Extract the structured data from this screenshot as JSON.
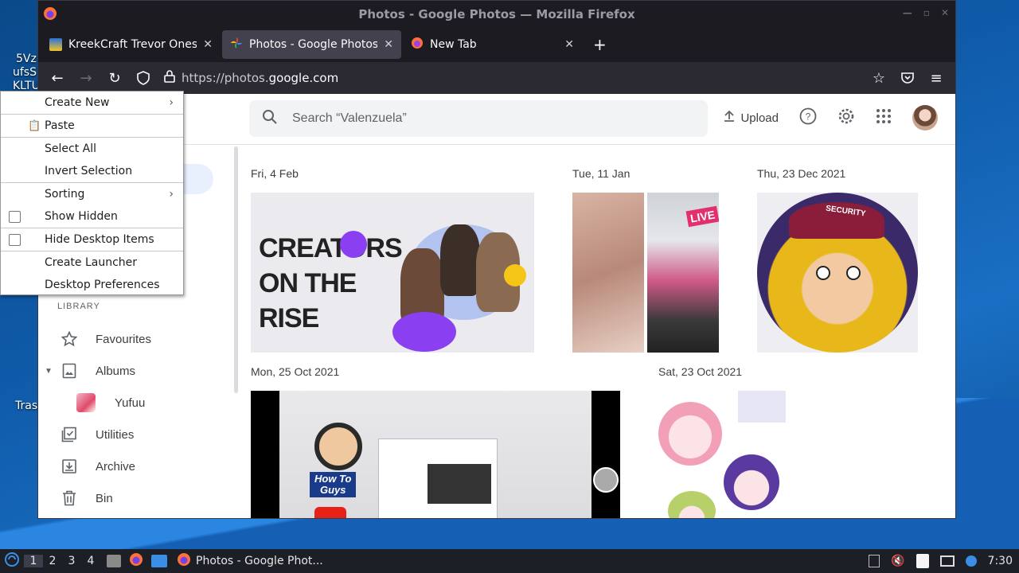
{
  "desktop": {
    "icon_text_1": "5Vz",
    "icon_text_2": "ufsS",
    "icon_text_3": "KLTU",
    "trash_text": "Tras"
  },
  "window": {
    "title": "Photos - Google Photos — Mozilla Firefox"
  },
  "tabs": [
    {
      "label": "KreekCraft Trevor Onesie"
    },
    {
      "label": "Photos - Google Photos"
    },
    {
      "label": "New Tab"
    }
  ],
  "navbar": {
    "url_prefix": "https://photos.",
    "url_host": "google.com"
  },
  "photos_page": {
    "search_placeholder": "Search “Valenzuela”",
    "upload_label": "Upload",
    "library_label": "LIBRARY",
    "sidebar": [
      {
        "label": "Favourites",
        "icon": "star-icon"
      },
      {
        "label": "Albums",
        "icon": "album-icon"
      },
      {
        "label": "Yufuu",
        "icon": "album-thumb"
      },
      {
        "label": "Utilities",
        "icon": "utilities-icon"
      },
      {
        "label": "Archive",
        "icon": "archive-icon"
      },
      {
        "label": "Bin",
        "icon": "bin-icon"
      }
    ],
    "groups": [
      {
        "date": "Fri, 4 Feb"
      },
      {
        "date": "Tue, 11 Jan"
      },
      {
        "date": "Thu, 23 Dec 2021"
      },
      {
        "date": "Mon, 25 Oct 2021"
      },
      {
        "date": "Sat, 23 Oct 2021"
      }
    ],
    "banner_line1": "CREATORS",
    "banner_line2": "ON THE",
    "banner_line3": "RISE",
    "cup_text": "LIVE",
    "cap_text": "SECURITY",
    "video_caption_1": "How To",
    "video_caption_2": "Guys"
  },
  "context_menu": {
    "items": [
      {
        "label": "Create New"
      },
      {
        "label": "Paste"
      },
      {
        "label": "Select All"
      },
      {
        "label": "Invert Selection"
      },
      {
        "label": "Sorting"
      },
      {
        "label": "Show Hidden"
      },
      {
        "label": "Hide Desktop Items"
      },
      {
        "label": "Create Launcher"
      },
      {
        "label": "Desktop Preferences"
      }
    ]
  },
  "taskbar": {
    "workspaces": [
      "1",
      "2",
      "3",
      "4"
    ],
    "active_app": "Photos - Google Phot...",
    "clock": "7:30"
  },
  "colors": {
    "accent": "#1a73e8",
    "firefox_dark": "#1c1b22"
  }
}
